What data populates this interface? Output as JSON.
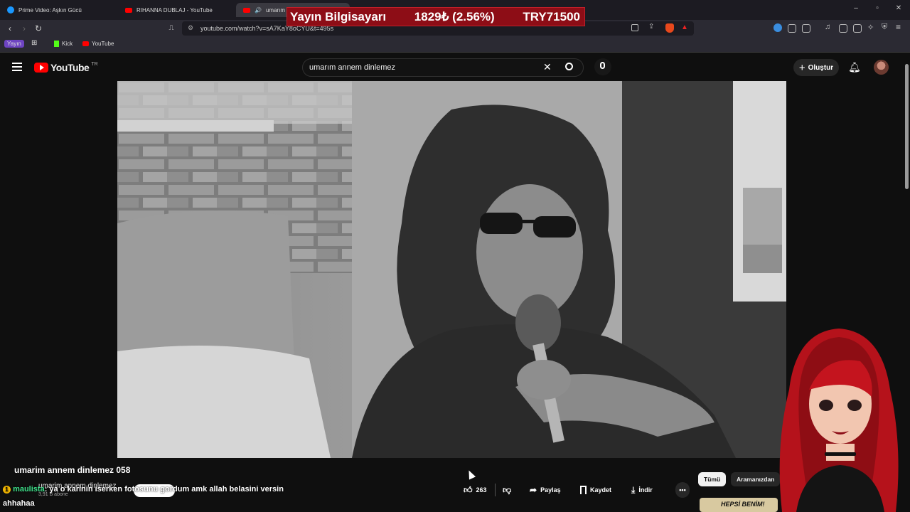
{
  "browser": {
    "tabs": [
      {
        "label": "Prime Video: Aşkın Gücü",
        "favicon_color": "#1a98ff"
      },
      {
        "label": "RIHANNA DUBLAJ - YouTube",
        "favicon_color": "#ff0000"
      },
      {
        "label": "umarım a...",
        "favicon_color": "#ff0000"
      }
    ],
    "url": "youtube.com/watch?v=sA7KaY8oCYU&t=495s",
    "bookmarks": [
      {
        "label": "Yayın"
      },
      {
        "label": "Kick",
        "color": "#53fc18"
      },
      {
        "label": "YouTube",
        "color": "#ff0000"
      }
    ]
  },
  "overlay": {
    "ticker_name": "Yayın Bilgisayarı",
    "ticker_change": "1829₺ (2.56%)",
    "ticker_price": "TRY71500"
  },
  "youtube": {
    "logo_text": "YouTube",
    "logo_region": "TR",
    "search_value": "umarım annem dinlemez",
    "create_label": "Oluştur"
  },
  "video": {
    "title": "umarim annem dinlemez 058",
    "channel": "umarim annem dinlemez",
    "subscribers": "3,91 B abone",
    "likes": "263",
    "share_label": "Paylaş",
    "save_label": "Kaydet",
    "download_label": "İndir"
  },
  "chips": [
    {
      "label": "Tümü"
    },
    {
      "label": "Aramanızdan"
    }
  ],
  "thumbnail_text": "HEPSİ BENİM!",
  "chat": {
    "badge": "1",
    "username": "maulista",
    "message": ": ya o karinin iserken fotosunu gordum amk allah belasini versin",
    "message2": "ahhahaa"
  },
  "colors": {
    "accent_red": "#ff0000",
    "ticker_bg": "#8d0d16",
    "bg": "#0f0f0f"
  }
}
